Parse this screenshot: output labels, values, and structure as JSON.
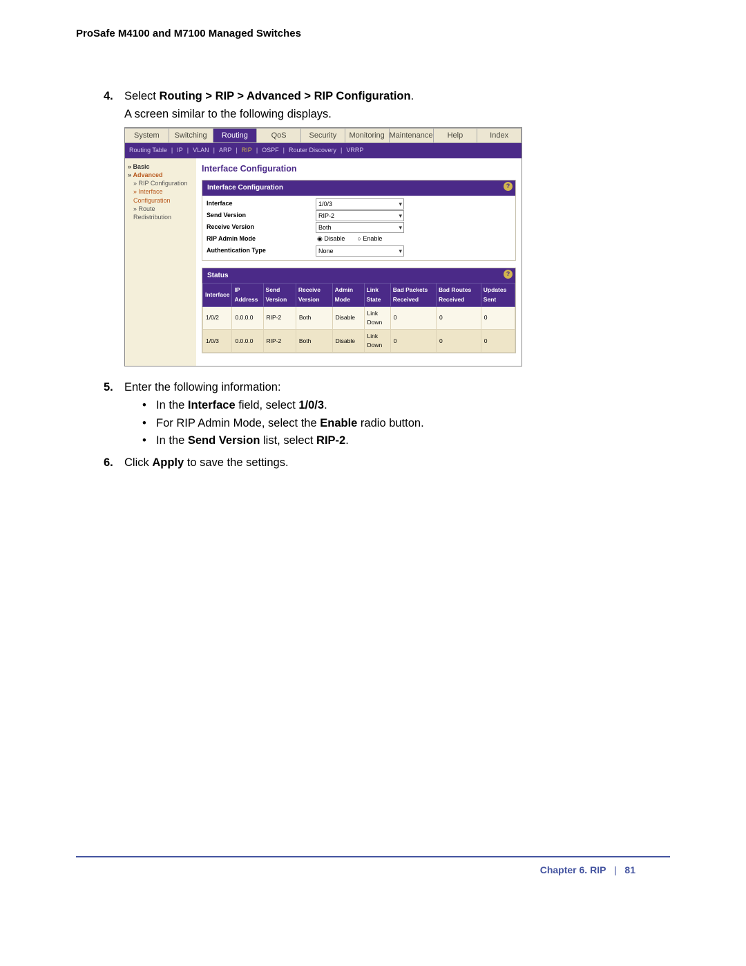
{
  "doc_header": "ProSafe M4100 and M7100 Managed Switches",
  "step4": {
    "num": "4.",
    "lead": "Select ",
    "path": "Routing > RIP > Advanced > RIP Configuration",
    "tail": ".",
    "after": "A screen similar to the following displays."
  },
  "step5": {
    "num": "5.",
    "text": "Enter the following information:",
    "b1_pre": "In the ",
    "b1_b1": "Interface",
    "b1_mid": " field, select ",
    "b1_b2": "1/0/3",
    "b1_tail": ".",
    "b2_pre": "For RIP Admin Mode, select the ",
    "b2_b1": "Enable",
    "b2_tail": " radio button.",
    "b3_pre": "In the ",
    "b3_b1": "Send Version",
    "b3_mid": " list, select ",
    "b3_b2": "RIP-2",
    "b3_tail": "."
  },
  "step6": {
    "num": "6.",
    "pre": "Click ",
    "b": "Apply",
    "tail": " to save the settings."
  },
  "footer": {
    "chapter": "Chapter 6.  RIP",
    "sep": "|",
    "page": "81"
  },
  "ui": {
    "tabs": [
      "System",
      "Switching",
      "Routing",
      "QoS",
      "Security",
      "Monitoring",
      "Maintenance",
      "Help",
      "Index"
    ],
    "tabs_active_idx": 2,
    "subnav": [
      "Routing Table",
      "IP",
      "VLAN",
      "ARP",
      "RIP",
      "OSPF",
      "Router Discovery",
      "VRRP"
    ],
    "subnav_active_idx": 4,
    "sidebar": {
      "basic": "Basic",
      "advanced": "Advanced",
      "leaves": [
        "RIP Configuration",
        "Interface Configuration",
        "Route Redistribution"
      ],
      "active_leaf_idx": 1
    },
    "page_title": "Interface Configuration",
    "panel_title": "Interface Configuration",
    "fields": {
      "interface": {
        "label": "Interface",
        "value": "1/0/3"
      },
      "send_version": {
        "label": "Send Version",
        "value": "RIP-2"
      },
      "receive_version": {
        "label": "Receive Version",
        "value": "Both"
      },
      "admin_mode": {
        "label": "RIP Admin Mode",
        "disable": "Disable",
        "enable": "Enable"
      },
      "auth_type": {
        "label": "Authentication Type",
        "value": "None"
      }
    },
    "status_title": "Status",
    "status_cols": [
      "Interface",
      "IP Address",
      "Send Version",
      "Receive Version",
      "Admin Mode",
      "Link State",
      "Bad Packets Received",
      "Bad Routes Received",
      "Updates Sent"
    ],
    "status_rows": [
      {
        "iface": "1/0/2",
        "ip": "0.0.0.0",
        "sv": "RIP-2",
        "rv": "Both",
        "am": "Disable",
        "ls": "Link Down",
        "bp": "0",
        "br": "0",
        "us": "0"
      },
      {
        "iface": "1/0/3",
        "ip": "0.0.0.0",
        "sv": "RIP-2",
        "rv": "Both",
        "am": "Disable",
        "ls": "Link Down",
        "bp": "0",
        "br": "0",
        "us": "0"
      }
    ]
  }
}
